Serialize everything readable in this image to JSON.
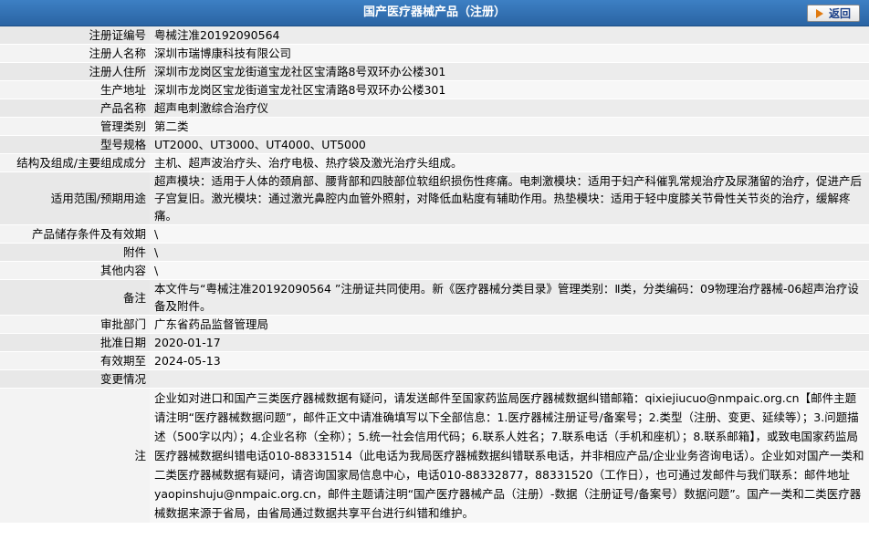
{
  "header": {
    "title": "国产医疗器械产品（注册）",
    "back_label": "返回"
  },
  "rows": [
    {
      "label": "注册证编号",
      "value": "粤械注准20192090564"
    },
    {
      "label": "注册人名称",
      "value": "深圳市瑞博康科技有限公司"
    },
    {
      "label": "注册人住所",
      "value": "深圳市龙岗区宝龙街道宝龙社区宝清路8号双环办公楼301"
    },
    {
      "label": "生产地址",
      "value": "深圳市龙岗区宝龙街道宝龙社区宝清路8号双环办公楼301"
    },
    {
      "label": "产品名称",
      "value": "超声电刺激综合治疗仪"
    },
    {
      "label": "管理类别",
      "value": "第二类"
    },
    {
      "label": "型号规格",
      "value": "UT2000、UT3000、UT4000、UT5000"
    },
    {
      "label": "结构及组成/主要组成成分",
      "value": "主机、超声波治疗头、治疗电极、热疗袋及激光治疗头组成。"
    },
    {
      "label": "适用范围/预期用途",
      "value": "超声模块：适用于人体的颈肩部、腰背部和四肢部位软组织损伤性疼痛。电刺激模块：适用于妇产科催乳常规治疗及尿潴留的治疗，促进产后子宫复旧。激光模块：通过激光鼻腔内血管外照射，对降低血粘度有辅助作用。热垫模块：适用于轻中度膝关节骨性关节炎的治疗，缓解疼痛。"
    },
    {
      "label": "产品储存条件及有效期",
      "value": "\\"
    },
    {
      "label": "附件",
      "value": "\\"
    },
    {
      "label": "其他内容",
      "value": "\\"
    },
    {
      "label": "备注",
      "value": "本文件与“粤械注准20192090564 ”注册证共同使用。新《医疗器械分类目录》管理类别：Ⅱ类，分类编码：09物理治疗器械-06超声治疗设备及附件。"
    },
    {
      "label": "审批部门",
      "value": "广东省药品监督管理局"
    },
    {
      "label": "批准日期",
      "value": "2020-01-17"
    },
    {
      "label": "有效期至",
      "value": "2024-05-13"
    },
    {
      "label": "变更情况",
      "value": ""
    }
  ],
  "note": {
    "label": "注",
    "text": "企业如对进口和国产三类医疗器械数据有疑问，请发送邮件至国家药监局医疗器械数据纠错邮箱：qixiejiucuo@nmpaic.org.cn【邮件主题请注明“医疗器械数据问题”，邮件正文中请准确填写以下全部信息：1.医疗器械注册证号/备案号；2.类型（注册、变更、延续等）；3.问题描述（500字以内）；4.企业名称（全称）；5.统一社会信用代码；6.联系人姓名；7.联系电话（手机和座机）；8.联系邮箱】，或致电国家药监局医疗器械数据纠错电话010-88331514（此电话为我局医疗器械数据纠错联系电话，并非相应产品/企业业务咨询电话）。企业如对国产一类和二类医疗器械数据有疑问，请咨询国家局信息中心，电话010-88332877，88331520（工作日），也可通过发邮件与我们联系：邮件地址yaopinshuju@nmpaic.org.cn，邮件主题请注明“国产医疗器械产品（注册）-数据（注册证号/备案号）数据问题”。国产一类和二类医疗器械数据来源于省局，由省局通过数据共享平台进行纠错和维护。"
  }
}
